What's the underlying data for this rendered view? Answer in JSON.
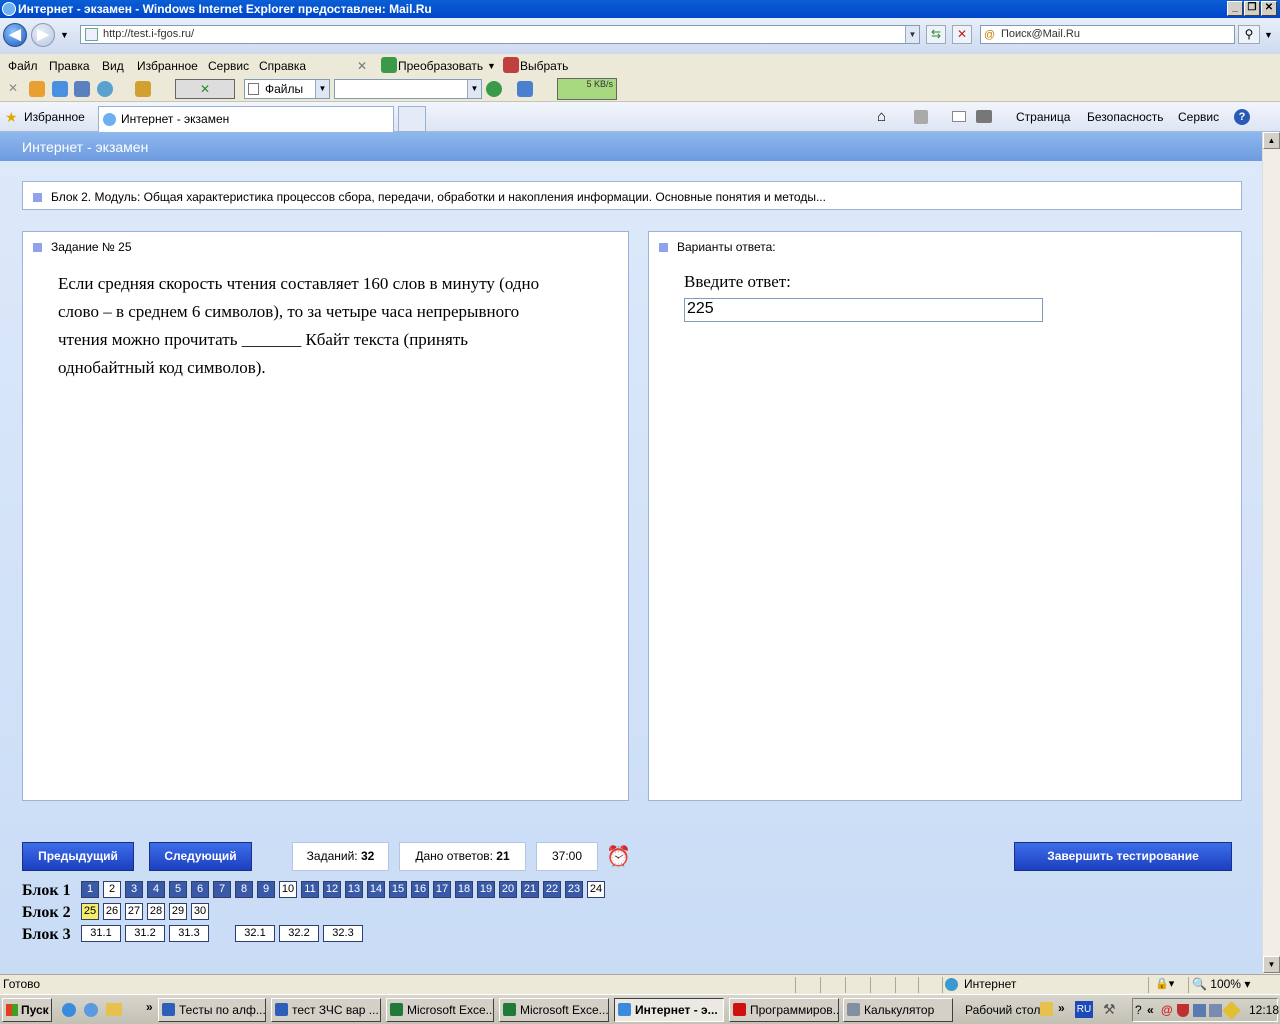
{
  "window": {
    "title": "Интернет - экзамен - Windows Internet Explorer предоставлен: Mail.Ru"
  },
  "address": {
    "url": "http://test.i-fgos.ru/",
    "search_placeholder": "Поиск@Mail.Ru"
  },
  "menu": [
    "Файл",
    "Правка",
    "Вид",
    "Избранное",
    "Сервис",
    "Справка"
  ],
  "toolbar": {
    "convert": "Преобразовать",
    "select": "Выбрать",
    "files": "Файлы",
    "speed": "5 KB/s"
  },
  "favorites": {
    "label": "Избранное",
    "tab": "Интернет - экзамен",
    "commands": [
      "Страница",
      "Безопасность",
      "Сервис"
    ]
  },
  "page": {
    "header": "Интернет - экзамен",
    "module": "Блок 2. Модуль: Общая характеристика процессов сбора, передачи, обработки и накопления информации. Основные понятия и методы...",
    "task_title": "Задание № 25",
    "question_lines": [
      "Если средняя скорость чтения составляет 160 слов в минуту (одно",
      "слово – в среднем 6 символов), то за четыре часа непрерывного",
      "чтения можно прочитать _______ Кбайт текста (принять",
      "однобайтный код символов)."
    ],
    "answers_title": "Варианты ответа:",
    "answer_label": "Введите ответ:",
    "answer_value": "225",
    "prev": "Предыдущий",
    "next": "Следующий",
    "tasks_label": "Заданий:",
    "tasks_count": "32",
    "answered_label": "Дано ответов:",
    "answered_count": "21",
    "timer": "37:00",
    "finish": "Завершить тестирование",
    "blocks": [
      {
        "label": "Блок 1",
        "items": [
          {
            "n": "1",
            "s": "ans"
          },
          {
            "n": "2",
            "s": "un"
          },
          {
            "n": "3",
            "s": "ans"
          },
          {
            "n": "4",
            "s": "ans"
          },
          {
            "n": "5",
            "s": "ans"
          },
          {
            "n": "6",
            "s": "ans"
          },
          {
            "n": "7",
            "s": "ans"
          },
          {
            "n": "8",
            "s": "ans"
          },
          {
            "n": "9",
            "s": "ans"
          },
          {
            "n": "10",
            "s": "un"
          },
          {
            "n": "11",
            "s": "ans"
          },
          {
            "n": "12",
            "s": "ans"
          },
          {
            "n": "13",
            "s": "ans"
          },
          {
            "n": "14",
            "s": "ans"
          },
          {
            "n": "15",
            "s": "ans"
          },
          {
            "n": "16",
            "s": "ans"
          },
          {
            "n": "17",
            "s": "ans"
          },
          {
            "n": "18",
            "s": "ans"
          },
          {
            "n": "19",
            "s": "ans"
          },
          {
            "n": "20",
            "s": "ans"
          },
          {
            "n": "21",
            "s": "ans"
          },
          {
            "n": "22",
            "s": "ans"
          },
          {
            "n": "23",
            "s": "ans"
          },
          {
            "n": "24",
            "s": "un"
          }
        ]
      },
      {
        "label": "Блок 2",
        "items": [
          {
            "n": "25",
            "s": "cur"
          },
          {
            "n": "26",
            "s": "un"
          },
          {
            "n": "27",
            "s": "un"
          },
          {
            "n": "28",
            "s": "un"
          },
          {
            "n": "29",
            "s": "un"
          },
          {
            "n": "30",
            "s": "un"
          }
        ]
      },
      {
        "label": "Блок 3",
        "items": [
          {
            "n": "31.1",
            "s": "un"
          },
          {
            "n": "31.2",
            "s": "un"
          },
          {
            "n": "31.3",
            "s": "un"
          },
          {
            "n": "32.1",
            "s": "un"
          },
          {
            "n": "32.2",
            "s": "un"
          },
          {
            "n": "32.3",
            "s": "un"
          }
        ]
      }
    ]
  },
  "status": {
    "text": "Готово",
    "zone": "Интернет",
    "zoom": "100%"
  },
  "taskbar": {
    "start": "Пуск",
    "tasks": [
      {
        "label": "Тесты по алф...",
        "icon": "word-icon",
        "color": "#2b5fb8"
      },
      {
        "label": "тест ЗЧС вар ...",
        "icon": "word-icon",
        "color": "#2b5fb8"
      },
      {
        "label": "Microsoft Exce...",
        "icon": "excel-icon",
        "color": "#1f7a3a"
      },
      {
        "label": "Microsoft Exce...",
        "icon": "excel-icon",
        "color": "#1f7a3a"
      },
      {
        "label": "Интернет - э...",
        "icon": "ie-icon",
        "color": "#3a8ae0",
        "active": true
      },
      {
        "label": "Программиров...",
        "icon": "opera-icon",
        "color": "#d01010"
      },
      {
        "label": "Калькулятор",
        "icon": "calculator-icon",
        "color": "#8090a0"
      }
    ],
    "desktop": "Рабочий стол",
    "lang": "RU",
    "clock": "12:18"
  }
}
